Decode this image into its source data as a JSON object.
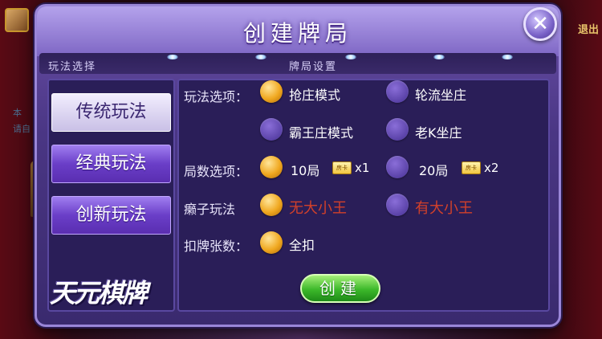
{
  "dialog": {
    "title": "创建牌局",
    "left_header": "玩法选择",
    "right_header": "牌局设置",
    "create_label": "创建"
  },
  "background": {
    "exit_label": "退出",
    "side_text_1": "本",
    "side_text_2": "请自"
  },
  "modes": [
    {
      "label": "传统玩法",
      "active": true
    },
    {
      "label": "经典玩法",
      "active": false
    },
    {
      "label": "创新玩法",
      "active": false
    }
  ],
  "logo": "天元棋牌",
  "settings": {
    "play_option": {
      "label": "玩法选项：",
      "options": [
        {
          "label": "抢庄模式",
          "selected": true
        },
        {
          "label": "轮流坐庄",
          "selected": false
        },
        {
          "label": "霸王庄模式",
          "selected": false
        },
        {
          "label": "老K坐庄",
          "selected": false
        }
      ]
    },
    "rounds_option": {
      "label": "局数选项：",
      "options": [
        {
          "label": "10局",
          "card_icon": "房卡",
          "multiplier": "x1",
          "selected": true
        },
        {
          "label": "20局",
          "card_icon": "房卡",
          "multiplier": "x2",
          "selected": false
        }
      ]
    },
    "wildcard_option": {
      "label": "癞子玩法",
      "options": [
        {
          "label": "无大小王",
          "selected": true
        },
        {
          "label": "有大小王",
          "selected": false
        }
      ]
    },
    "deduct_option": {
      "label": "扣牌张数：",
      "options": [
        {
          "label": "全扣",
          "selected": true
        }
      ]
    }
  },
  "colors": {
    "dialog_purple": "#4a3684",
    "selected_radio": "#f0a820",
    "wildcard_red": "#d2402a",
    "create_green": "#3cb82a"
  }
}
